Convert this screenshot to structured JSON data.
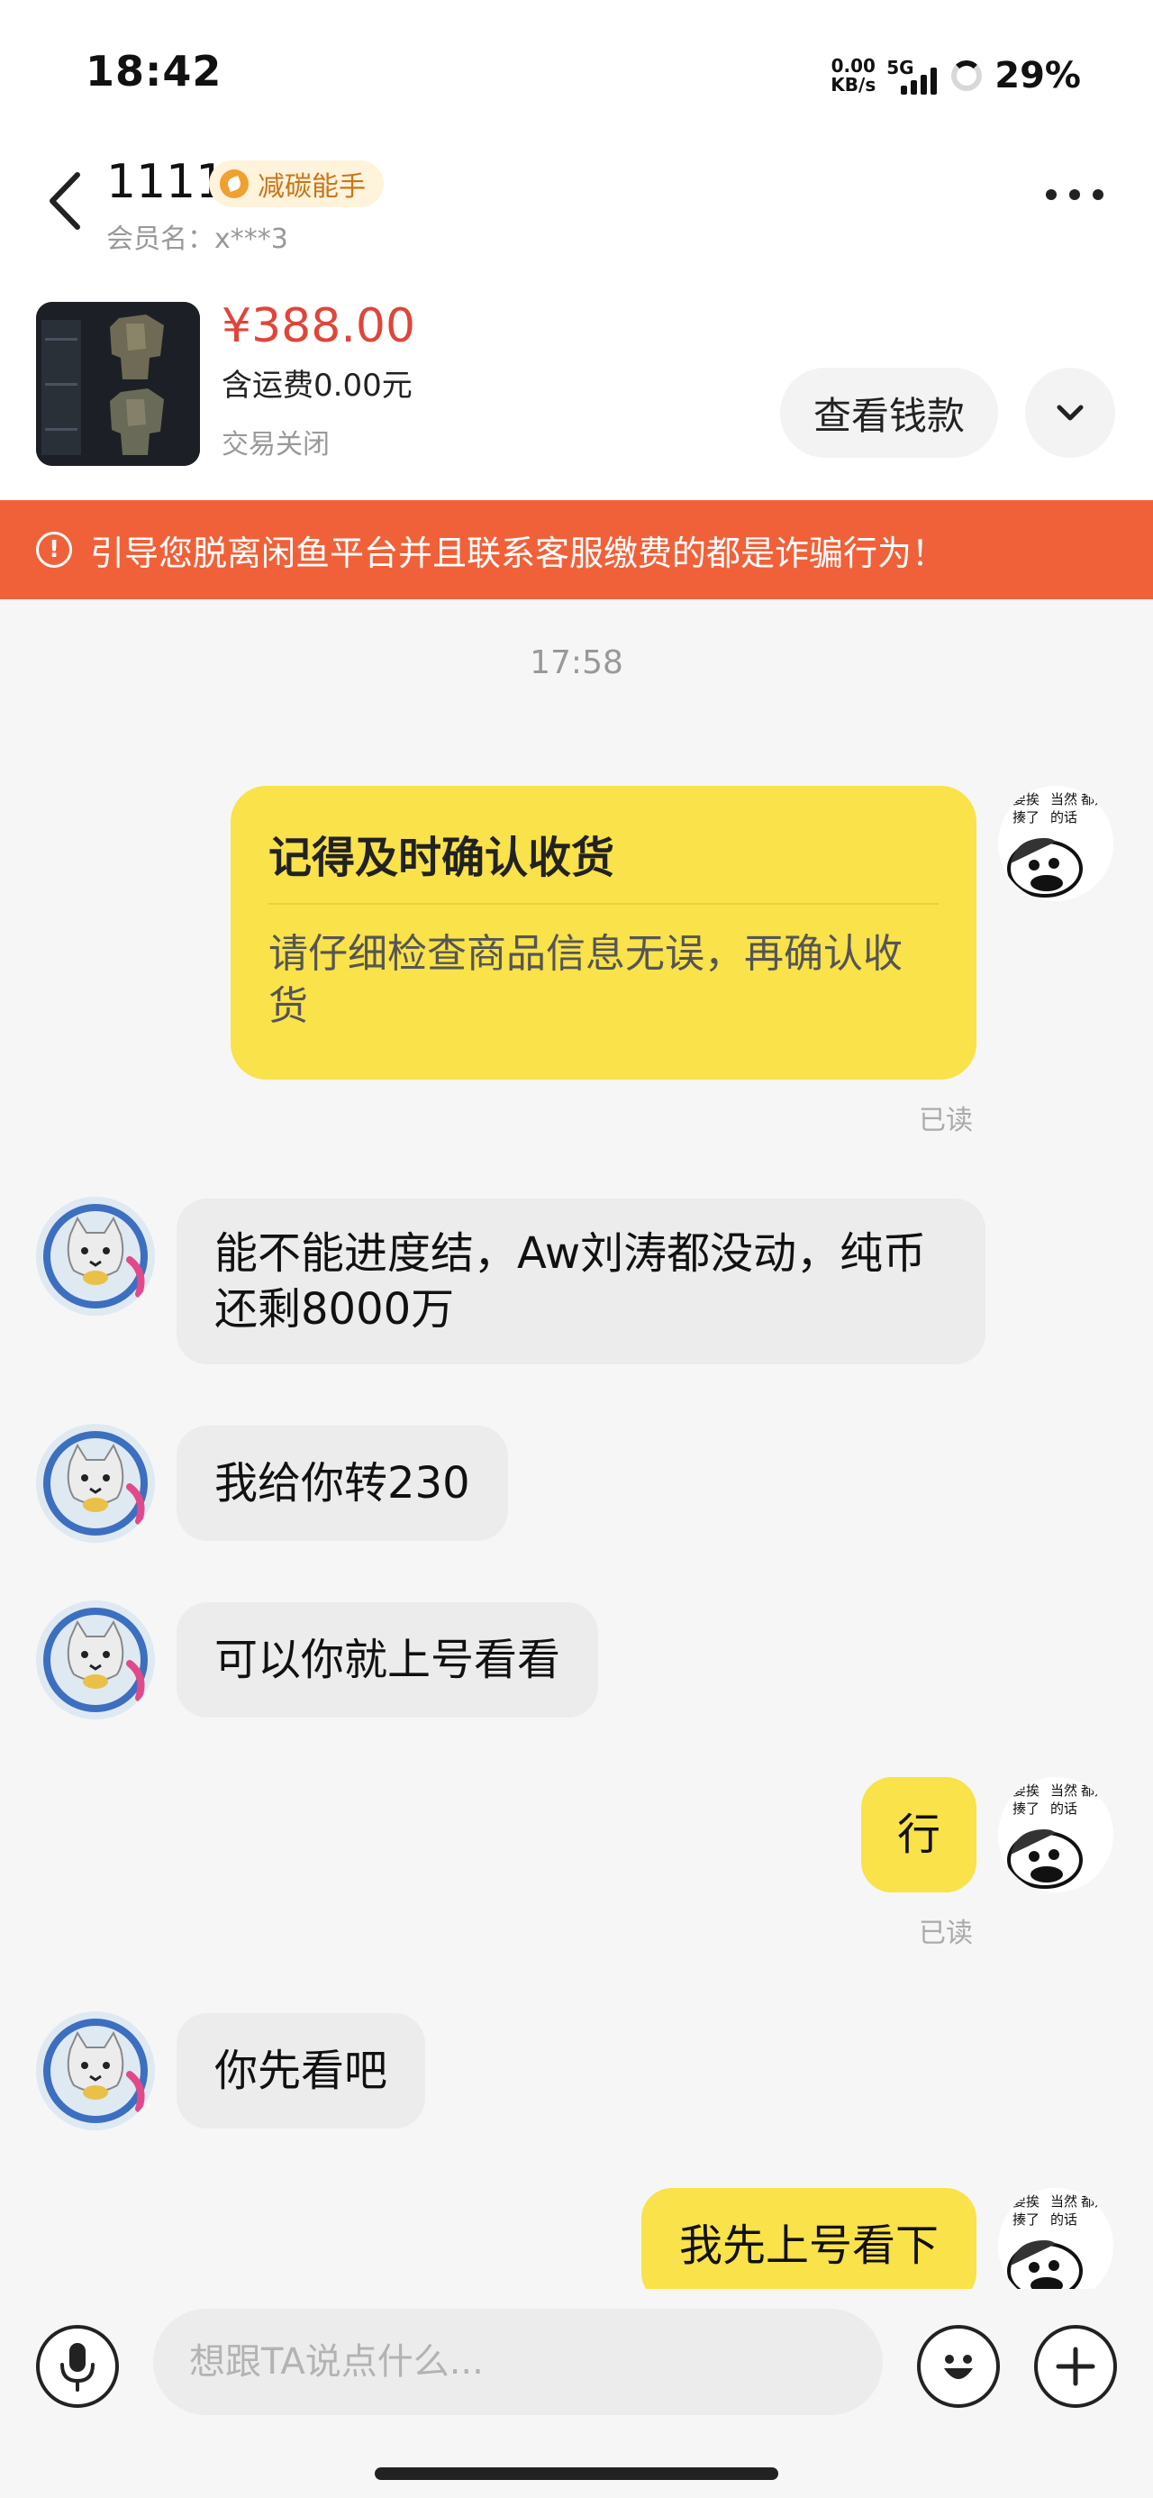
{
  "status_bar": {
    "time": "18:42",
    "net_speed_value": "0.00",
    "net_speed_unit": "KB/s",
    "signal": "5G",
    "battery": "29%"
  },
  "header": {
    "nickname": "1111",
    "badge": "减碳能手",
    "member_label": "会员名：x***3"
  },
  "product": {
    "price": "¥388.00",
    "shipping": "含运费0.00元",
    "status": "交易关闭",
    "view_button": "查看钱款"
  },
  "warning": "引导您脱离闲鱼平台并且联系客服缴费的都是诈骗行为！",
  "chat": {
    "timestamp": "17:58",
    "reminder": {
      "title": "记得及时确认收货",
      "body": "请仔细检查商品信息无误，再确认收货"
    },
    "read_label": "已读",
    "messages": [
      {
        "from": "other",
        "text": "能不能进度结，Aw刘涛都没动，纯币还剩8000万"
      },
      {
        "from": "other",
        "text": "我给你转230"
      },
      {
        "from": "other",
        "text": "可以你就上号看看"
      },
      {
        "from": "me",
        "text": "行"
      },
      {
        "from": "other",
        "text": "你先看吧"
      },
      {
        "from": "me",
        "text": "我先上号看下"
      }
    ],
    "sticker_text": [
      "要挨",
      "当然",
      "都是说些",
      "揍了",
      "的话"
    ]
  },
  "input": {
    "placeholder": "想跟TA说点什么..."
  },
  "colors": {
    "accent_yellow": "#f9e24a",
    "warning_orange": "#f06139",
    "price_red": "#e0453a"
  }
}
